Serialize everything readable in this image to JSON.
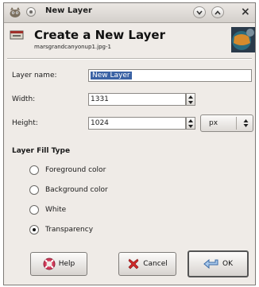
{
  "window": {
    "title": "New Layer"
  },
  "header": {
    "title": "Create a New Layer",
    "subtitle": "marsgrandcanyonup1.jpg-1"
  },
  "form": {
    "layer_name_label": "Layer name:",
    "layer_name_value": "New Layer",
    "width_label": "Width:",
    "width_value": "1331",
    "height_label": "Height:",
    "height_value": "1024",
    "unit_value": "px"
  },
  "fill_type": {
    "heading": "Layer Fill Type",
    "options": [
      {
        "label": "Foreground color",
        "selected": false
      },
      {
        "label": "Background color",
        "selected": false
      },
      {
        "label": "White",
        "selected": false
      },
      {
        "label": "Transparency",
        "selected": true
      }
    ]
  },
  "buttons": {
    "help": "Help",
    "cancel": "Cancel",
    "ok": "OK"
  },
  "icons": [
    "gimp-app-icon",
    "pin-icon",
    "chevron-down-icon",
    "chevron-up-icon",
    "close-icon",
    "layer-icon",
    "image-thumbnail",
    "help-icon",
    "cancel-icon",
    "ok-icon"
  ]
}
